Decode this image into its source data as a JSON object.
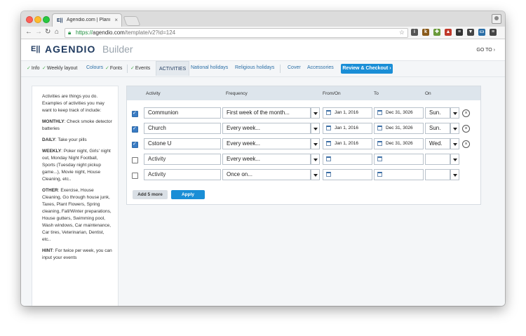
{
  "browser": {
    "tab_title": "Agendio.com | Planner Bui",
    "tab_close": "×",
    "url_scheme": "https://",
    "url_host": "agendio.com",
    "url_path": "/template/v2?id=124",
    "extensions": [
      {
        "name": "info-ext-icon",
        "glyph": "i",
        "color": "#555555"
      },
      {
        "name": "k-ext-icon",
        "glyph": "k",
        "color": "#8a5a1a"
      },
      {
        "name": "puzzle-ext-icon",
        "glyph": "✚",
        "color": "#6a9a3a"
      },
      {
        "name": "hat-ext-icon",
        "glyph": "▲",
        "color": "#c0392b"
      },
      {
        "name": "layers-ext-icon",
        "glyph": "≡",
        "color": "#333333"
      },
      {
        "name": "pocket-ext-icon",
        "glyph": "▼",
        "color": "#444444"
      },
      {
        "name": "screen-ext-icon",
        "glyph": "▭",
        "color": "#2a6ea6"
      },
      {
        "name": "menu-icon",
        "glyph": "≡",
        "color": "#444444"
      }
    ]
  },
  "header": {
    "logo_glyph": "E||",
    "brand": "AGENDIO",
    "subtitle": "Builder",
    "goto": "GO TO  ›"
  },
  "nav": {
    "info": "Info",
    "weekly_layout": "Weekly layout",
    "colours": "Colours",
    "fonts": "Fonts",
    "events": "Events",
    "activities": "ACTIVITIES",
    "national_holidays": "National holidays",
    "religious_holidays": "Religious holidays",
    "cover": "Cover",
    "accessories": "Accessories",
    "review": "Review & Checkout  ›"
  },
  "sidebar": {
    "intro": "Activities are things you do. Examples of activities you may want to keep track of include:",
    "items": [
      {
        "label": "MONTHLY",
        "text": ": Check smoke detector batteries"
      },
      {
        "label": "DAILY",
        "text": ": Take your pills"
      },
      {
        "label": "WEEKLY",
        "text": ": Poker night, Girls' night out, Monday Night Football, Sports (Tuesday night pickup game...), Movie night, House Cleaning, etc.."
      },
      {
        "label": "OTHER",
        "text": ": Exercise, House Cleaning, Go through house junk, Taxes, Plant Flowers, Spring cleaning, Fall/Winter preparations, House gutters, Swimming pool, Wash windows, Car maintenance, Car tires, Veterinarian, Dentist, etc.."
      },
      {
        "label": "HINT",
        "text": ": For twice per week, you can input your events"
      }
    ]
  },
  "table": {
    "headers": {
      "activity": "Activity",
      "frequency": "Frequency",
      "from": "From/On",
      "to": "To",
      "on": "On"
    },
    "rows": [
      {
        "checked": true,
        "activity": "Communion",
        "frequency": "First week of the month...",
        "from": "Jan 1, 2016",
        "to": "Dec 31, 3026",
        "on": "Sun.",
        "removable": true
      },
      {
        "checked": true,
        "activity": "Church",
        "frequency": "Every week...",
        "from": "Jan 1, 2016",
        "to": "Dec 31, 3026",
        "on": "Sun.",
        "removable": true
      },
      {
        "checked": true,
        "activity": "Cstone U",
        "frequency": "Every week...",
        "from": "Jan 1, 2016",
        "to": "Dec 31, 3026",
        "on": "Wed.",
        "removable": true
      },
      {
        "checked": false,
        "activity": "Activity",
        "frequency": "Every week...",
        "from": "",
        "to": "",
        "on": "",
        "removable": false
      },
      {
        "checked": false,
        "activity": "Activity",
        "frequency": "Once on...",
        "from": "",
        "to": "",
        "on": "",
        "removable": false
      }
    ],
    "add_more": "Add 5 more",
    "apply": "Apply"
  }
}
